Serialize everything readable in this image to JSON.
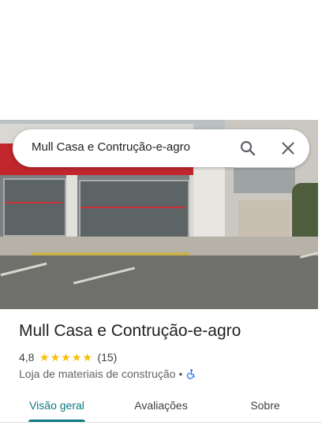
{
  "search": {
    "query": "Mull Casa e Contrução-e-agro"
  },
  "place": {
    "name": "Mull Casa e Contrução-e-agro",
    "rating": "4,8",
    "stars": 5,
    "review_count": "(15)",
    "category": "Loja de materiais de construção",
    "separator": "•"
  },
  "tabs": [
    {
      "label": "Visão geral",
      "active": true
    },
    {
      "label": "Avaliações",
      "active": false
    },
    {
      "label": "Sobre",
      "active": false
    }
  ],
  "icons": {
    "search": "search-icon",
    "close": "close-icon",
    "accessibility": "wheelchair-accessible-icon"
  },
  "colors": {
    "accent": "#0b7a82",
    "star": "#fbbc04",
    "accessible_icon": "#1a73e8"
  }
}
